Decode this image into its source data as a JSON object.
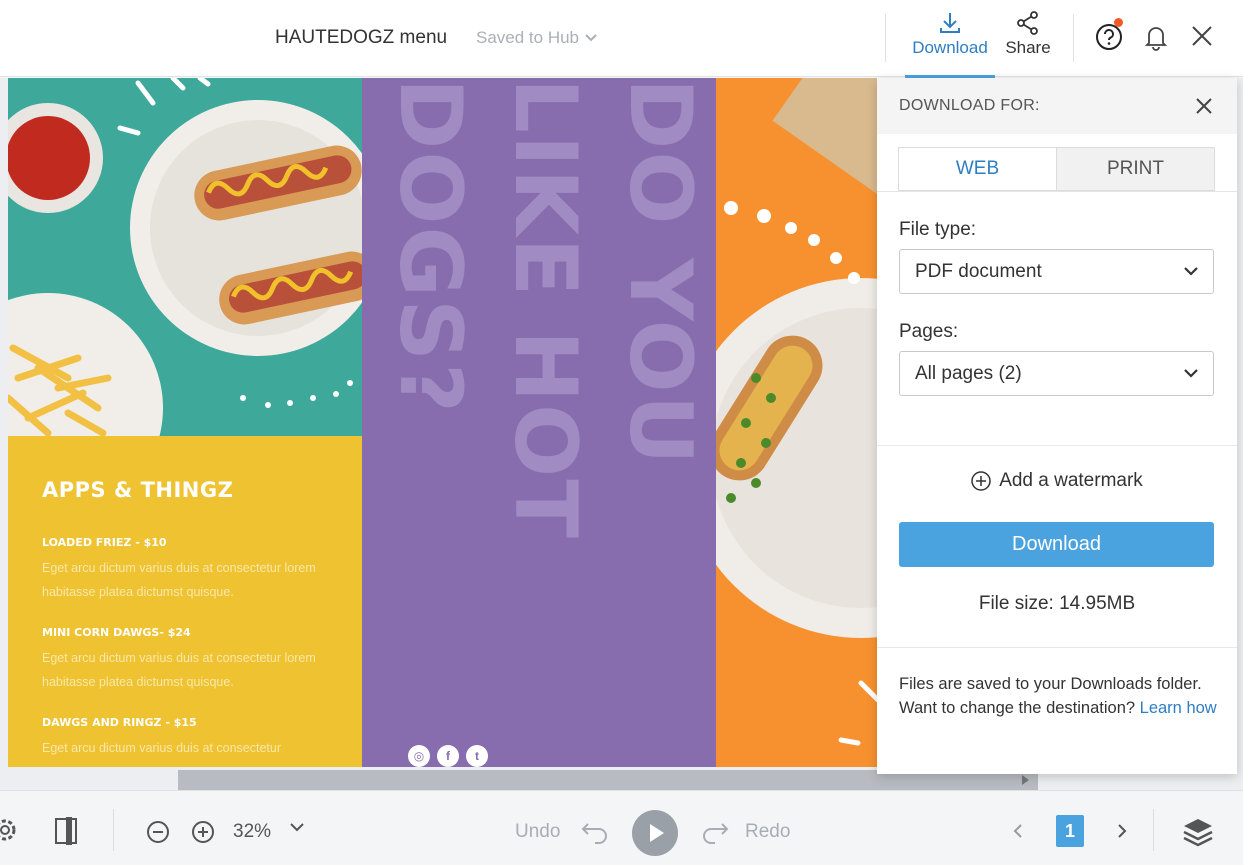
{
  "header": {
    "title": "HAUTEDOGZ menu",
    "save_status": "Saved to Hub",
    "download_label": "Download",
    "share_label": "Share"
  },
  "design": {
    "menu": {
      "title": "APPS & THINGZ",
      "items": [
        {
          "name": "LOADED FRIEZ - $10",
          "desc": "Eget arcu dictum varius duis at consectetur lorem habitasse platea dictumst quisque."
        },
        {
          "name": "MINI CORN DAWGS- $24",
          "desc": "Eget arcu dictum varius duis at consectetur lorem habitasse platea dictumst quisque."
        },
        {
          "name": "DAWGS AND RINGZ - $15",
          "desc": "Eget arcu dictum varius duis at consectetur"
        }
      ]
    },
    "headline_col1": "DO YOU",
    "headline_col2": "LIKE HOT",
    "headline_col3": "DOGS?",
    "social": [
      "instagram-icon",
      "facebook-icon",
      "twitter-icon"
    ],
    "colors": {
      "teal": "#3ea99b",
      "yellow": "#efc232",
      "purple": "#876dad",
      "orange": "#f7912f"
    }
  },
  "download_panel": {
    "title": "DOWNLOAD FOR:",
    "tabs": [
      {
        "label": "WEB",
        "active": true
      },
      {
        "label": "PRINT",
        "active": false
      }
    ],
    "file_type_label": "File type:",
    "file_type_value": "PDF document",
    "pages_label": "Pages:",
    "pages_value": "All pages (2)",
    "watermark_label": "Add a watermark",
    "download_button": "Download",
    "file_size": "File size: 14.95MB",
    "note": "Files are saved to your Downloads folder. Want to change the destination?",
    "learn_how": "Learn how"
  },
  "toolbar": {
    "zoom": "32%",
    "undo": "Undo",
    "redo": "Redo",
    "page": "1"
  },
  "accent": "#4aa3df"
}
